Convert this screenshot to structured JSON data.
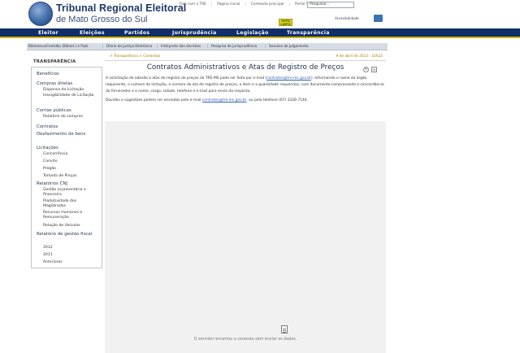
{
  "header": {
    "title": "Tribunal Regional Eleitoral",
    "subtitle": "de Mato Grosso do Sul",
    "top_links": [
      "Fale com o TRE",
      "Página inicial",
      "Conteúdo principal",
      "Portal TE"
    ],
    "search_value": "Pesquisar...",
    "vote_badge": "VOTO LIMPO",
    "accessibility_label": "Acessibilidade"
  },
  "nav": {
    "items": [
      "Eleitor",
      "Eleições",
      "Partidos",
      "Jurisprudência",
      "Legislação",
      "Transparência"
    ]
  },
  "subnav": {
    "items": [
      "Biblioteca/Certidão (Bibliot.) e Publ.",
      "Diário da Justiça Eletrônico",
      "Intérprete das decisões",
      "Pesquisa de jurisprudência",
      "Sessões de Julgamento"
    ]
  },
  "sidebar": {
    "title": "TRANSPARÊNCIA",
    "links": [
      {
        "label": "Benefícios",
        "subs": []
      },
      {
        "label": "Compras diretas",
        "subs": [
          "Dispensa de Licitação",
          "Inexigibilidade de Licitação"
        ]
      },
      {
        "label": "Contas públicas",
        "subs": [
          "Relatório de compras"
        ]
      },
      {
        "label": "Contratos",
        "subs": []
      },
      {
        "label": "Desfazimento de bens",
        "subs": []
      },
      {
        "label": "Licitações",
        "subs": [
          "Concorrência",
          "Convite",
          "Pregão",
          "Tomada de Preços"
        ]
      },
      {
        "label": "Relatórios CNJ",
        "subs": [
          "Gestão orçamentária e financeira",
          "Produtividade dos Magistrados",
          "Recursos Humanos e Remuneração",
          "Relação de Veículos"
        ]
      },
      {
        "label": "Relatório de gestão fiscal",
        "subs": [
          "2012",
          "2011",
          "Anteriores"
        ]
      }
    ]
  },
  "content": {
    "breadcrumb": "> Transparência > Contratos",
    "date": "9 de abril de 2013 - 10h22",
    "title": "Contratos Administrativos e Atas de Registro de Preços",
    "para1_a": "A solicitação de adesão à atas de registro de preços do TRE-MS pode ser feita por e-mail (",
    "para1_mail": "contratos@tre-ms.gov.br",
    "para1_b": "). Informando o nome do órgão requerente, o número da licitação, o número da ata de registro de preços, o item e a quantidade requeridas, com documento comprovando a concordância do fornecedor e o nome, cargo, cidade, telefone e e-mail para envio da resposta.",
    "para2_a": "Dúvidas e sugestões podem ser enviadas pelo e-mail ",
    "para2_mail": "contratos@tre-ms.gov.br",
    "para2_b": ", ou pelo telefone (67) 3326-7144.",
    "tool_plus": "+",
    "tool_print": "≡",
    "error_message": "O servidor encerrou a conexão sem enviar os dados."
  },
  "colors": {
    "nav_bg": "#0f2f6a",
    "nav_accent": "#d8b400",
    "link": "#3060b0",
    "breadcrumb": "#a87a00"
  }
}
